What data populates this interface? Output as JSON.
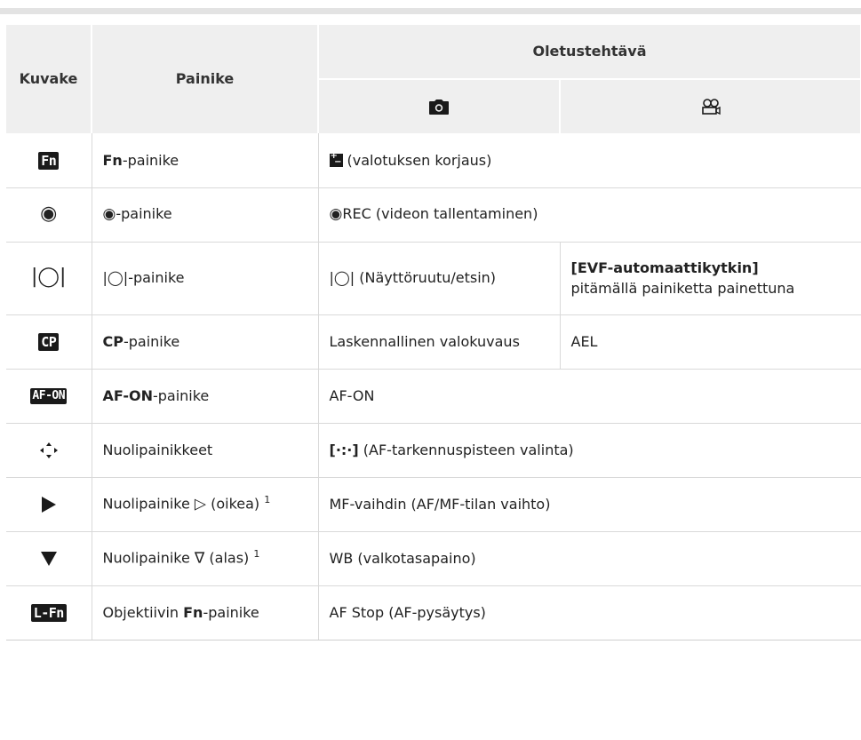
{
  "header": {
    "kuvake": "Kuvake",
    "painike": "Painike",
    "oletus": "Oletustehtävä",
    "photo_icon": "camera-icon",
    "movie_icon": "movie-camera-icon"
  },
  "rows": [
    {
      "icon": "Fn",
      "button_bold": "Fn",
      "button_rest": "-painike",
      "task": "(valotuksen korjaus)"
    },
    {
      "icon": "record-icon",
      "button_symbol": "◉",
      "button_rest": "-painike",
      "task_symbol": "◉",
      "task": "REC (videon tallentaminen)"
    },
    {
      "icon": "viewfinder-switch-icon",
      "button_symbol": "|◯|",
      "button_rest": "-painike",
      "task_symbol": "|◯|",
      "task": "(Näyttöruutu/etsin)",
      "movie_bold": "[EVF-automaattikytkin]",
      "movie_rest": "pitämällä painiketta painettuna"
    },
    {
      "icon": "CP",
      "button_bold": "CP",
      "button_rest": "-painike",
      "task": "Laskennallinen valokuvaus",
      "movie": "AEL"
    },
    {
      "icon": "AF-ON",
      "button_bold": "AF-ON",
      "button_rest": "-painike",
      "task": "AF-ON"
    },
    {
      "icon": "arrow-pad-icon",
      "button": "Nuolipainikkeet",
      "task_symbol": "[·:·]",
      "task": "(AF-tarkennuspisteen valinta)"
    },
    {
      "icon": "right-triangle-icon",
      "button": "Nuolipainike",
      "button_symbol": "▷",
      "button_rest": "(oikea)",
      "sup": "1",
      "task": "MF-vaihdin (AF/MF-tilan vaihto)"
    },
    {
      "icon": "down-triangle-icon",
      "button": "Nuolipainike",
      "button_symbol": "∇",
      "button_rest": "(alas)",
      "sup": "1",
      "task": "WB (valkotasapaino)"
    },
    {
      "icon": "L-Fn",
      "button": "Objektiivin",
      "button_bold": "Fn",
      "button_rest": "-painike",
      "task": "AF Stop (AF-pysäytys)"
    }
  ]
}
